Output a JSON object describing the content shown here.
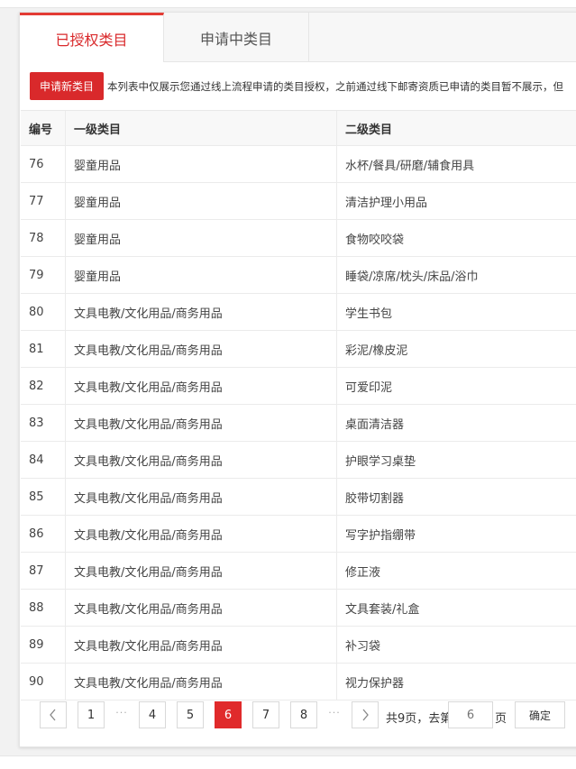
{
  "tabs": [
    {
      "label": "已授权类目",
      "active": true
    },
    {
      "label": "申请中类目",
      "active": false
    }
  ],
  "apply_button": "申请新类目",
  "notice": "本列表中仅展示您通过线上流程申请的类目授权，之前通过线下邮寄资质已申请的类目暂不展示，但",
  "table": {
    "headers": [
      "编号",
      "一级类目",
      "二级类目"
    ],
    "rows": [
      {
        "id": "76",
        "level1": "婴童用品",
        "level2": "水杯/餐具/研磨/辅食用具"
      },
      {
        "id": "77",
        "level1": "婴童用品",
        "level2": "清洁护理小用品"
      },
      {
        "id": "78",
        "level1": "婴童用品",
        "level2": "食物咬咬袋"
      },
      {
        "id": "79",
        "level1": "婴童用品",
        "level2": "睡袋/凉席/枕头/床品/浴巾"
      },
      {
        "id": "80",
        "level1": "文具电教/文化用品/商务用品",
        "level2": "学生书包"
      },
      {
        "id": "81",
        "level1": "文具电教/文化用品/商务用品",
        "level2": "彩泥/橡皮泥"
      },
      {
        "id": "82",
        "level1": "文具电教/文化用品/商务用品",
        "level2": "可爱印泥"
      },
      {
        "id": "83",
        "level1": "文具电教/文化用品/商务用品",
        "level2": "桌面清洁器"
      },
      {
        "id": "84",
        "level1": "文具电教/文化用品/商务用品",
        "level2": "护眼学习桌垫"
      },
      {
        "id": "85",
        "level1": "文具电教/文化用品/商务用品",
        "level2": "胶带切割器"
      },
      {
        "id": "86",
        "level1": "文具电教/文化用品/商务用品",
        "level2": "写字护指绷带"
      },
      {
        "id": "87",
        "level1": "文具电教/文化用品/商务用品",
        "level2": "修正液"
      },
      {
        "id": "88",
        "level1": "文具电教/文化用品/商务用品",
        "level2": "文具套装/礼盒"
      },
      {
        "id": "89",
        "level1": "文具电教/文化用品/商务用品",
        "level2": "补习袋"
      },
      {
        "id": "90",
        "level1": "文具电教/文化用品/商务用品",
        "level2": "视力保护器"
      }
    ]
  },
  "pagination": {
    "prev_icon": "chevron-left-icon",
    "next_icon": "chevron-right-icon",
    "pages": [
      "1",
      "4",
      "5",
      "6",
      "7",
      "8"
    ],
    "current": "6",
    "ellipsis": "···",
    "total_text": "共9页，去第",
    "goto_placeholder": "6",
    "unit": "页",
    "confirm": "确定"
  },
  "colors": {
    "accent": "#e02a2b",
    "border": "#e6e6e6"
  }
}
